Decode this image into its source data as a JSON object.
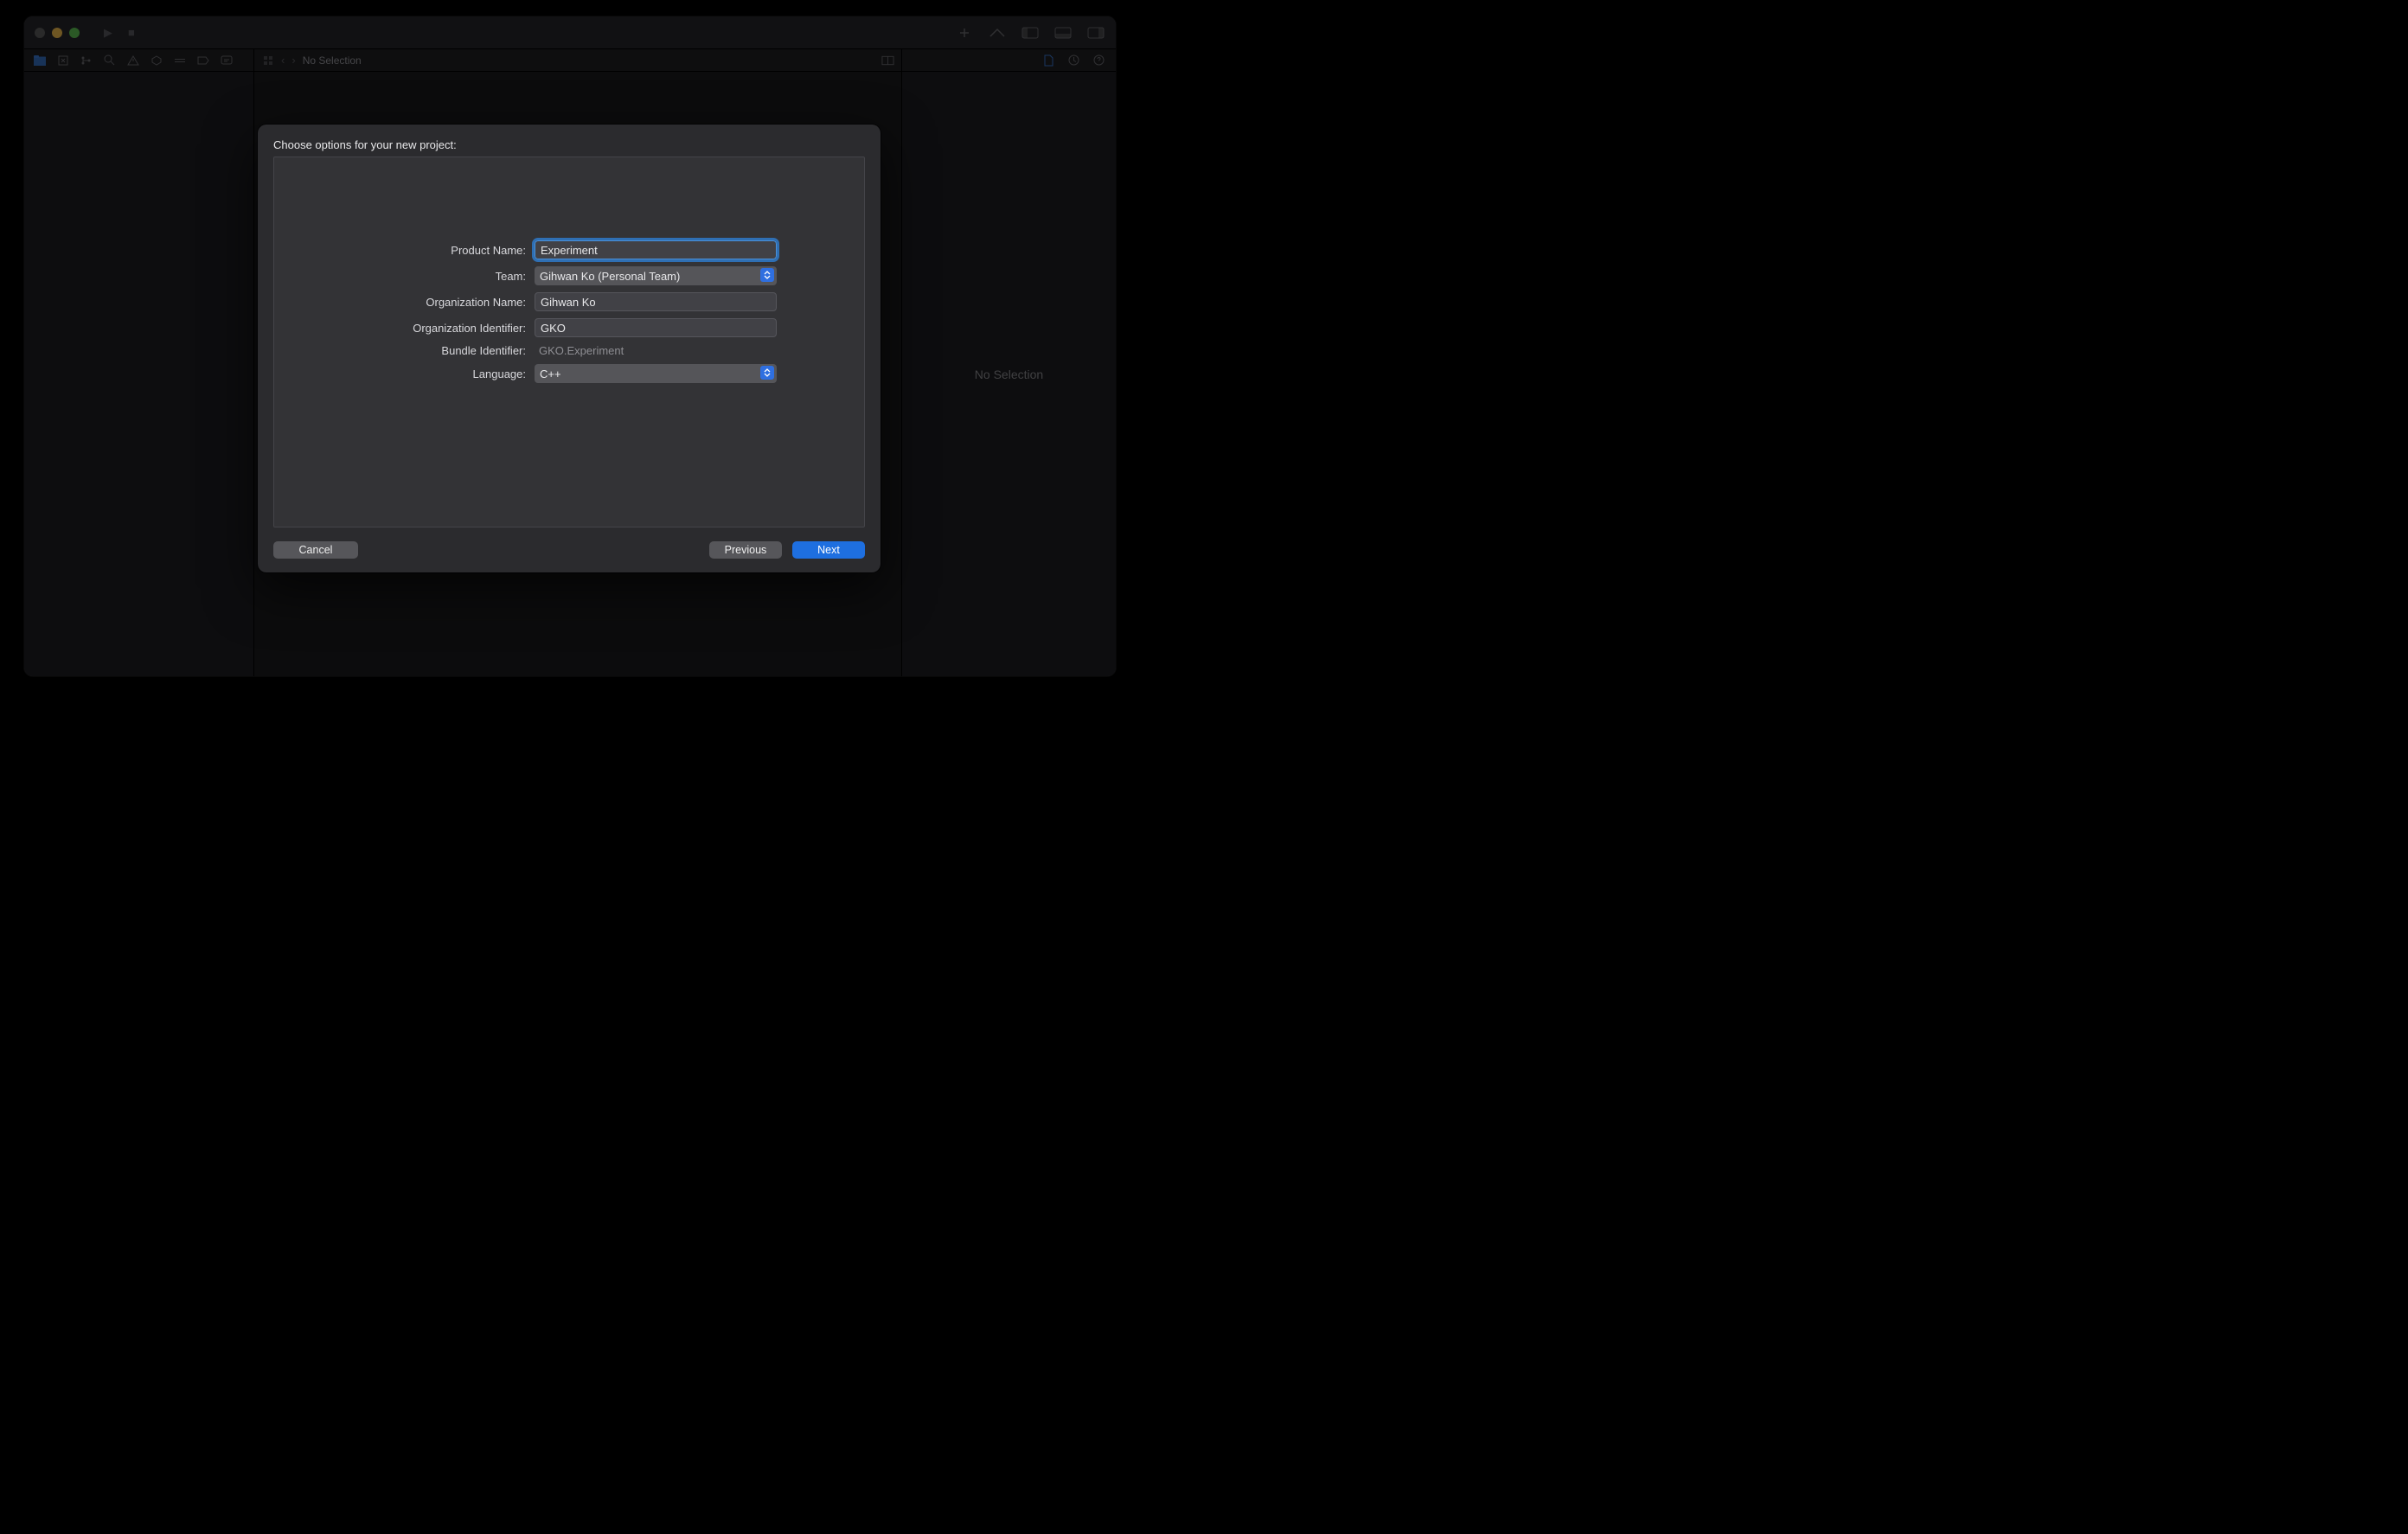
{
  "toolbar": {
    "no_selection": "No Selection"
  },
  "inspector": {
    "no_selection": "No Selection"
  },
  "sheet": {
    "title": "Choose options for your new project:",
    "labels": {
      "product_name": "Product Name:",
      "team": "Team:",
      "org_name": "Organization Name:",
      "org_id": "Organization Identifier:",
      "bundle_id": "Bundle Identifier:",
      "language": "Language:"
    },
    "values": {
      "product_name": "Experiment",
      "team": "Gihwan Ko (Personal Team)",
      "org_name": "Gihwan Ko",
      "org_id": "GKO",
      "bundle_id": "GKO.Experiment",
      "language": "C++"
    },
    "buttons": {
      "cancel": "Cancel",
      "previous": "Previous",
      "next": "Next"
    }
  }
}
